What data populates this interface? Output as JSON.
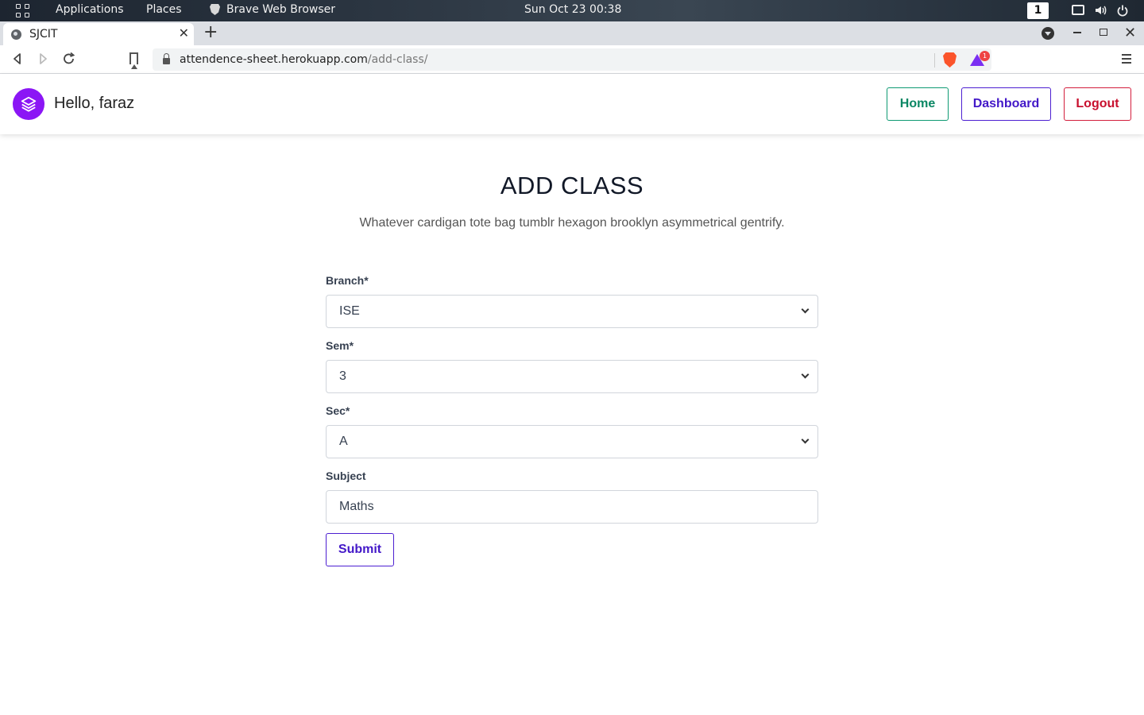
{
  "os": {
    "applications": "Applications",
    "places": "Places",
    "browser_name": "Brave Web Browser",
    "clock": "Sun Oct 23  00:38",
    "workspace": "1"
  },
  "browser": {
    "tab_title": "SJCIT",
    "url_host": "attendence-sheet.herokuapp.com",
    "url_path": "/add-class/",
    "rewards_count": "1"
  },
  "header": {
    "greeting": "Hello, faraz",
    "home": "Home",
    "dashboard": "Dashboard",
    "logout": "Logout"
  },
  "main": {
    "title": "ADD CLASS",
    "description": "Whatever cardigan tote bag tumblr hexagon brooklyn asymmetrical gentrify."
  },
  "form": {
    "branch_label": "Branch*",
    "branch_value": "ISE",
    "sem_label": "Sem*",
    "sem_value": "3",
    "sec_label": "Sec*",
    "sec_value": "A",
    "subject_label": "Subject",
    "subject_value": "Maths",
    "submit": "Submit"
  },
  "colors": {
    "logo": "#8b16f5",
    "home_accent": "#0e9a73",
    "dashboard_accent": "#4c1fd1",
    "logout_accent": "#d31d3c"
  }
}
